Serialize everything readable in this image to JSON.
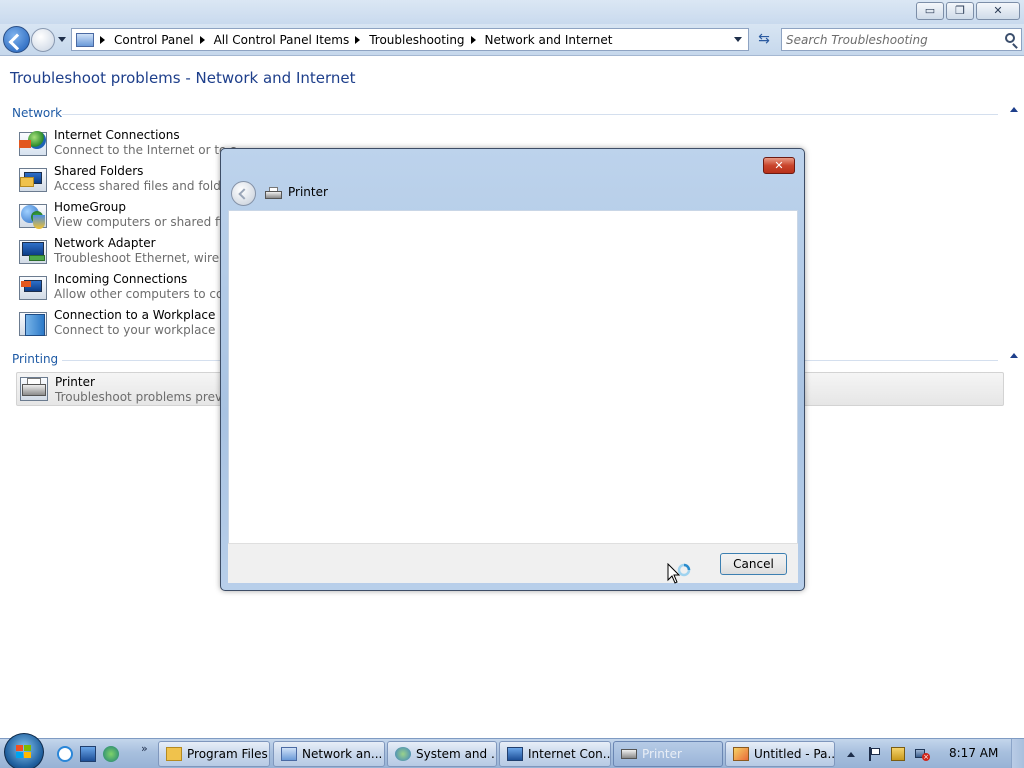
{
  "window": {
    "minimize": "▭",
    "restore": "❐",
    "close": "✕"
  },
  "address": {
    "breadcrumbs": [
      "Control Panel",
      "All Control Panel Items",
      "Troubleshooting",
      "Network and Internet"
    ],
    "search_placeholder": "Search Troubleshooting"
  },
  "page": {
    "title": "Troubleshoot problems - Network and Internet"
  },
  "sections": {
    "network": {
      "heading": "Network",
      "items": [
        {
          "name": "Internet Connections",
          "desc": "Connect to the Internet or to a",
          "icon": "internet-connections-icon"
        },
        {
          "name": "Shared Folders",
          "desc": "Access shared files and folders o",
          "icon": "shared-folders-icon"
        },
        {
          "name": "HomeGroup",
          "desc": "View computers or shared files i",
          "icon": "homegroup-icon"
        },
        {
          "name": "Network Adapter",
          "desc": "Troubleshoot Ethernet, wireless,",
          "icon": "network-adapter-icon"
        },
        {
          "name": "Incoming Connections",
          "desc": "Allow other computers to comm",
          "icon": "incoming-connections-icon"
        },
        {
          "name": "Connection to a Workplace Usin",
          "desc": "Connect to your workplace netw",
          "icon": "workplace-connection-icon"
        }
      ]
    },
    "printing": {
      "heading": "Printing",
      "items": [
        {
          "name": "Printer",
          "desc": "Troubleshoot problems prevent",
          "icon": "printer-icon"
        }
      ]
    }
  },
  "dialog": {
    "title": "Printer",
    "close_label": "✕",
    "cancel_label": "Cancel",
    "state": "busy"
  },
  "taskbar": {
    "overflow": "»",
    "buttons": [
      {
        "label": "Program Files",
        "icon": "folder-icon",
        "active": false
      },
      {
        "label": "Network an...",
        "icon": "control-panel-icon",
        "active": false
      },
      {
        "label": "System and ...",
        "icon": "system-icon",
        "active": false
      },
      {
        "label": "Internet Con...",
        "icon": "troubleshoot-icon",
        "active": false
      },
      {
        "label": "Printer",
        "icon": "printer-icon",
        "active": true
      },
      {
        "label": "Untitled - Pa...",
        "icon": "paint-icon",
        "active": false
      }
    ],
    "clock": "8:17 AM"
  },
  "colors": {
    "accent_title": "#1e3f8b",
    "section_heading": "#1e5aa5",
    "dialog_frame": "#a9c3e2",
    "close_red": "#c9452c"
  }
}
